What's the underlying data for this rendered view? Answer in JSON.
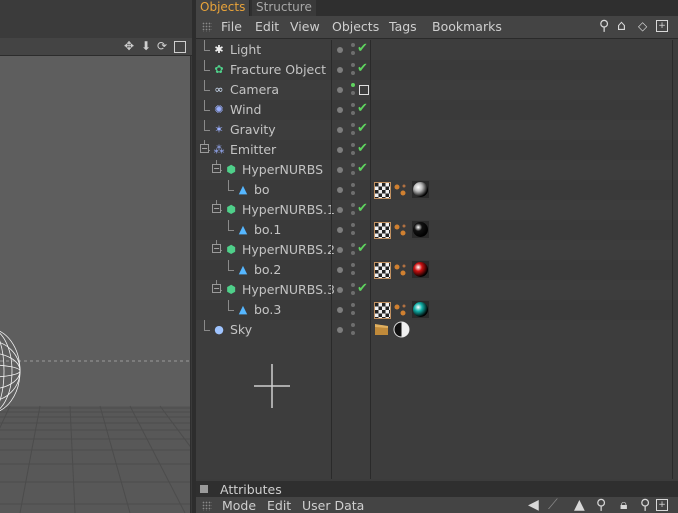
{
  "tabs": [
    {
      "label": "Objects"
    },
    {
      "label": "Structure"
    }
  ],
  "menu": [
    "File",
    "Edit",
    "View",
    "Objects",
    "Tags",
    "Bookmarks"
  ],
  "objects": [
    {
      "name": "Light",
      "indent": 0,
      "icon": "light-icon"
    },
    {
      "name": "Fracture Object",
      "indent": 0,
      "icon": "fracture-icon"
    },
    {
      "name": "Camera",
      "indent": 0,
      "icon": "camera-icon"
    },
    {
      "name": "Wind",
      "indent": 0,
      "icon": "wind-icon"
    },
    {
      "name": "Gravity",
      "indent": 0,
      "icon": "gravity-icon"
    },
    {
      "name": "Emitter",
      "indent": 0,
      "icon": "emitter-icon"
    },
    {
      "name": "HyperNURBS",
      "indent": 1,
      "icon": "hypernurbs-icon"
    },
    {
      "name": "bo",
      "indent": 2,
      "icon": "cone-icon"
    },
    {
      "name": "HyperNURBS.1",
      "indent": 1,
      "icon": "hypernurbs-icon"
    },
    {
      "name": "bo.1",
      "indent": 2,
      "icon": "cone-icon"
    },
    {
      "name": "HyperNURBS.2",
      "indent": 1,
      "icon": "hypernurbs-icon"
    },
    {
      "name": "bo.2",
      "indent": 2,
      "icon": "cone-icon"
    },
    {
      "name": "HyperNURBS.3",
      "indent": 1,
      "icon": "hypernurbs-icon"
    },
    {
      "name": "bo.3",
      "indent": 2,
      "icon": "cone-icon"
    },
    {
      "name": "Sky",
      "indent": 0,
      "icon": "sky-icon"
    }
  ],
  "materials": {
    "bo": "#bdbdbd",
    "bo.1": "#111111",
    "bo.2": "#cc1010",
    "bo.3": "#11b0a8"
  },
  "attributes": {
    "title": "Attributes",
    "menu": [
      "Mode",
      "Edit",
      "User Data"
    ]
  },
  "colors": {
    "accent": "#e8a33a",
    "check": "#5fd35f"
  }
}
